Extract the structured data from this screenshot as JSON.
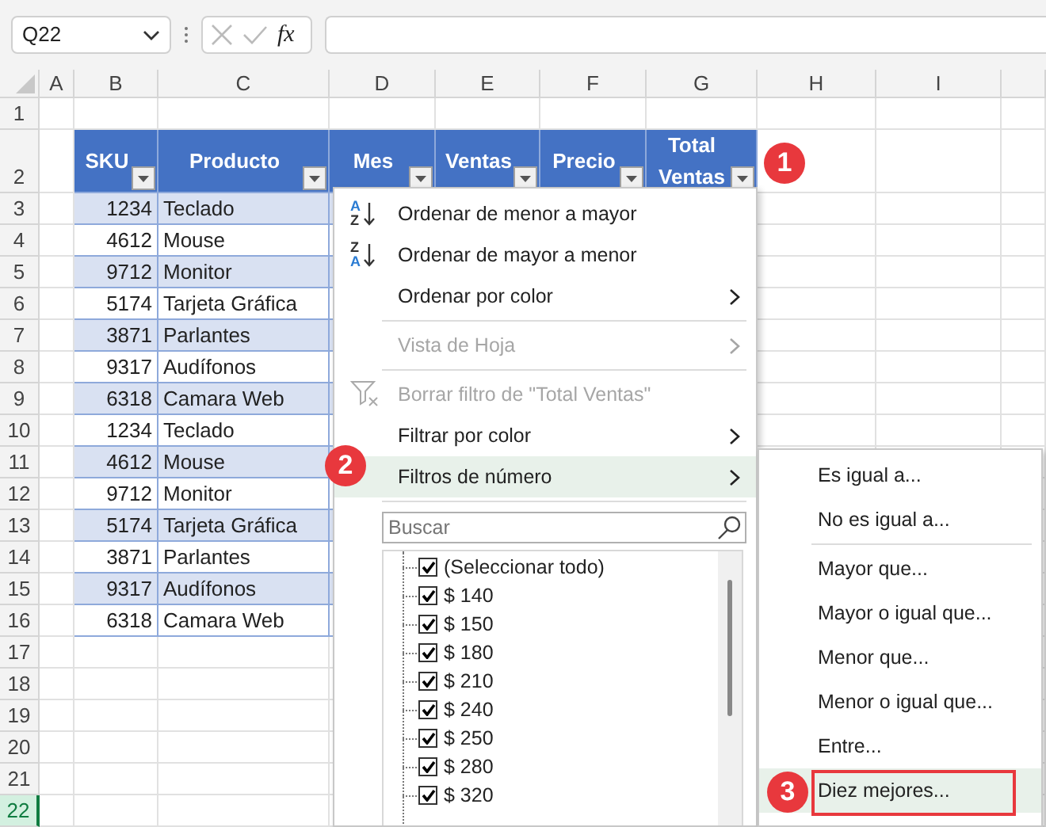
{
  "name_box": {
    "value": "Q22"
  },
  "formula_bar": {
    "function_label": "fx"
  },
  "column_headers": [
    "A",
    "B",
    "C",
    "D",
    "E",
    "F",
    "G",
    "H",
    "I"
  ],
  "row_headers": [
    {
      "label": "1",
      "selected": false
    },
    {
      "label": "2",
      "selected": false
    },
    {
      "label": "3",
      "selected": false
    },
    {
      "label": "4",
      "selected": false
    },
    {
      "label": "5",
      "selected": false
    },
    {
      "label": "6",
      "selected": false
    },
    {
      "label": "7",
      "selected": false
    },
    {
      "label": "8",
      "selected": false
    },
    {
      "label": "9",
      "selected": false
    },
    {
      "label": "10",
      "selected": false
    },
    {
      "label": "11",
      "selected": false
    },
    {
      "label": "12",
      "selected": false
    },
    {
      "label": "13",
      "selected": false
    },
    {
      "label": "14",
      "selected": false
    },
    {
      "label": "15",
      "selected": false
    },
    {
      "label": "16",
      "selected": false
    },
    {
      "label": "17",
      "selected": false
    },
    {
      "label": "18",
      "selected": false
    },
    {
      "label": "19",
      "selected": false
    },
    {
      "label": "20",
      "selected": false
    },
    {
      "label": "21",
      "selected": false
    },
    {
      "label": "22",
      "selected": true
    }
  ],
  "table": {
    "columns": [
      {
        "label": "SKU"
      },
      {
        "label": "Producto"
      },
      {
        "label": "Mes"
      },
      {
        "label": "Ventas"
      },
      {
        "label": "Precio"
      },
      {
        "label": "Total Ventas"
      }
    ],
    "rows": [
      {
        "sku": "1234",
        "producto": "Teclado"
      },
      {
        "sku": "4612",
        "producto": "Mouse"
      },
      {
        "sku": "9712",
        "producto": "Monitor"
      },
      {
        "sku": "5174",
        "producto": "Tarjeta Gráfica"
      },
      {
        "sku": "3871",
        "producto": "Parlantes"
      },
      {
        "sku": "9317",
        "producto": "Audífonos"
      },
      {
        "sku": "6318",
        "producto": "Camara Web"
      },
      {
        "sku": "1234",
        "producto": "Teclado"
      },
      {
        "sku": "4612",
        "producto": "Mouse"
      },
      {
        "sku": "9712",
        "producto": "Monitor"
      },
      {
        "sku": "5174",
        "producto": "Tarjeta Gráfica"
      },
      {
        "sku": "3871",
        "producto": "Parlantes"
      },
      {
        "sku": "9317",
        "producto": "Audífonos"
      },
      {
        "sku": "6318",
        "producto": "Camara Web"
      }
    ]
  },
  "filter_menu": {
    "items": [
      {
        "kind": "sort",
        "label": "Ordenar de menor a mayor",
        "icon_letters": [
          "A",
          "Z"
        ],
        "disabled": false,
        "selected": false
      },
      {
        "kind": "sort",
        "label": "Ordenar de mayor a menor",
        "icon_letters": [
          "Z",
          "A"
        ],
        "disabled": false,
        "selected": false
      },
      {
        "kind": "submenu",
        "label": "Ordenar por color",
        "disabled": false,
        "selected": false
      },
      {
        "kind": "separator"
      },
      {
        "kind": "submenu",
        "label": "Vista de Hoja",
        "disabled": true,
        "selected": false
      },
      {
        "kind": "separator"
      },
      {
        "kind": "clear",
        "label": "Borrar filtro de \"Total Ventas\"",
        "disabled": true,
        "selected": false
      },
      {
        "kind": "submenu",
        "label": "Filtrar por color",
        "disabled": false,
        "selected": false
      },
      {
        "kind": "submenu",
        "label": "Filtros de número",
        "disabled": false,
        "selected": true
      },
      {
        "kind": "separator"
      }
    ],
    "search": {
      "placeholder": "Buscar"
    },
    "values": [
      {
        "label": "(Seleccionar todo)",
        "checked": true
      },
      {
        "label": "$ 140",
        "checked": true
      },
      {
        "label": "$ 150",
        "checked": true
      },
      {
        "label": "$ 180",
        "checked": true
      },
      {
        "label": "$ 210",
        "checked": true
      },
      {
        "label": "$ 240",
        "checked": true
      },
      {
        "label": "$ 250",
        "checked": true
      },
      {
        "label": "$ 280",
        "checked": true
      },
      {
        "label": "$ 320",
        "checked": true
      }
    ]
  },
  "number_filters_menu": {
    "items": [
      {
        "kind": "item",
        "label": "Es igual a...",
        "selected": false,
        "marked": false
      },
      {
        "kind": "item",
        "label": "No es igual a...",
        "selected": false,
        "marked": false
      },
      {
        "kind": "separator"
      },
      {
        "kind": "item",
        "label": "Mayor que...",
        "selected": false,
        "marked": false
      },
      {
        "kind": "item",
        "label": "Mayor o igual que...",
        "selected": false,
        "marked": false
      },
      {
        "kind": "item",
        "label": "Menor que...",
        "selected": false,
        "marked": false
      },
      {
        "kind": "item",
        "label": "Menor o igual que...",
        "selected": false,
        "marked": false
      },
      {
        "kind": "item",
        "label": "Entre...",
        "selected": false,
        "marked": false
      },
      {
        "kind": "item",
        "label": "Diez mejores...",
        "selected": true,
        "marked": true
      }
    ]
  },
  "callouts": [
    "1",
    "2",
    "3"
  ]
}
